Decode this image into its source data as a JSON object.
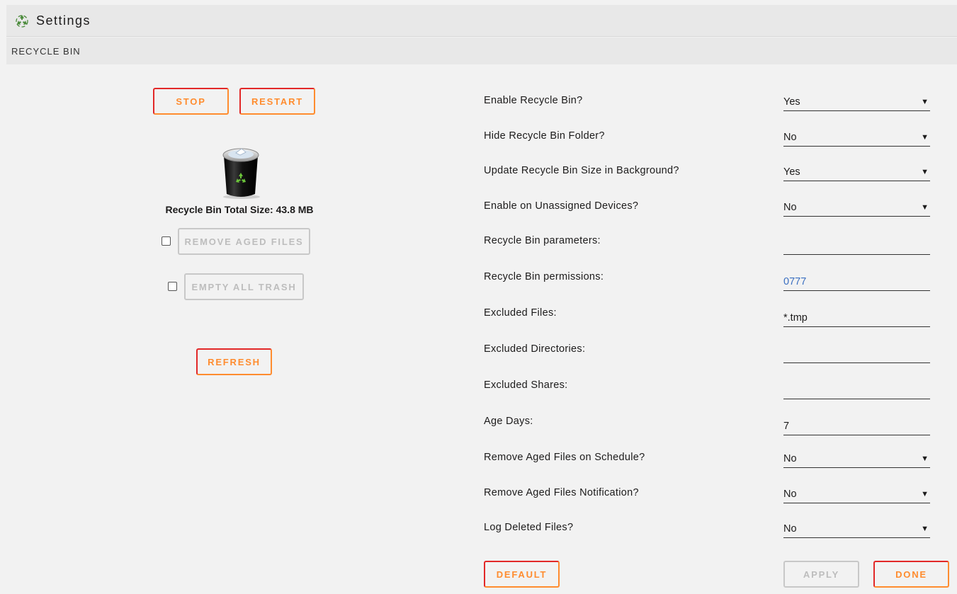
{
  "header": {
    "title": "Settings",
    "icon": "recycle-icon"
  },
  "section": {
    "title": "RECYCLE BIN"
  },
  "left": {
    "stop_label": "STOP",
    "restart_label": "RESTART",
    "size_text": "Recycle Bin Total Size: 43.8 MB",
    "remove_aged_label": "REMOVE AGED FILES",
    "empty_trash_label": "EMPTY ALL TRASH",
    "refresh_label": "REFRESH"
  },
  "settings": [
    {
      "label": "Enable Recycle Bin?",
      "value": "Yes",
      "type": "select"
    },
    {
      "label": "Hide Recycle Bin Folder?",
      "value": "No",
      "type": "select"
    },
    {
      "label": "Update Recycle Bin Size in Background?",
      "value": "Yes",
      "type": "select"
    },
    {
      "label": "Enable on Unassigned Devices?",
      "value": "No",
      "type": "select"
    },
    {
      "label": "Recycle Bin parameters:",
      "value": "",
      "type": "text"
    },
    {
      "label": "Recycle Bin permissions:",
      "value": "0777",
      "type": "text"
    },
    {
      "label": "Excluded Files:",
      "value": "*.tmp",
      "type": "text"
    },
    {
      "label": "Excluded Directories:",
      "value": "",
      "type": "text"
    },
    {
      "label": "Excluded Shares:",
      "value": "",
      "type": "text"
    },
    {
      "label": "Age Days:",
      "value": "7",
      "type": "text"
    },
    {
      "label": "Remove Aged Files on Schedule?",
      "value": "No",
      "type": "select"
    },
    {
      "label": "Remove Aged Files Notification?",
      "value": "No",
      "type": "select"
    },
    {
      "label": "Log Deleted Files?",
      "value": "No",
      "type": "select"
    }
  ],
  "footer": {
    "default_label": "DEFAULT",
    "apply_label": "APPLY",
    "done_label": "DONE"
  },
  "colors": {
    "accent": "#ff8c2f",
    "accent_dark": "#e22828",
    "link": "#3b6fc1"
  }
}
